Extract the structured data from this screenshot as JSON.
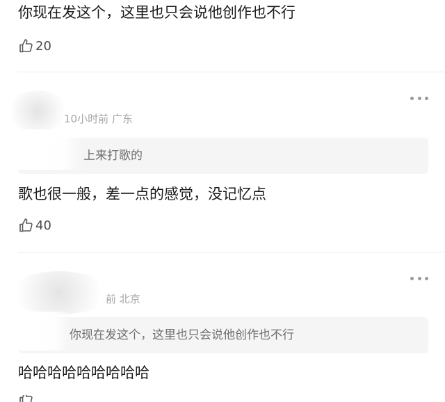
{
  "comments": [
    {
      "text": "你现在发这个，这里也只会说他创作也不行",
      "likes": "20"
    },
    {
      "meta": "10小时前 广东",
      "quote": "上来打歌的",
      "text": "歌也很一般，差一点的感觉，没记忆点",
      "likes": "40"
    },
    {
      "meta": "前 北京",
      "quote": "你现在发这个，这里也只会说他创作也不行",
      "text": "哈哈哈哈哈哈哈哈哈"
    }
  ],
  "icons": {
    "like": "thumbs-up-icon",
    "more": "more-dots-icon"
  }
}
